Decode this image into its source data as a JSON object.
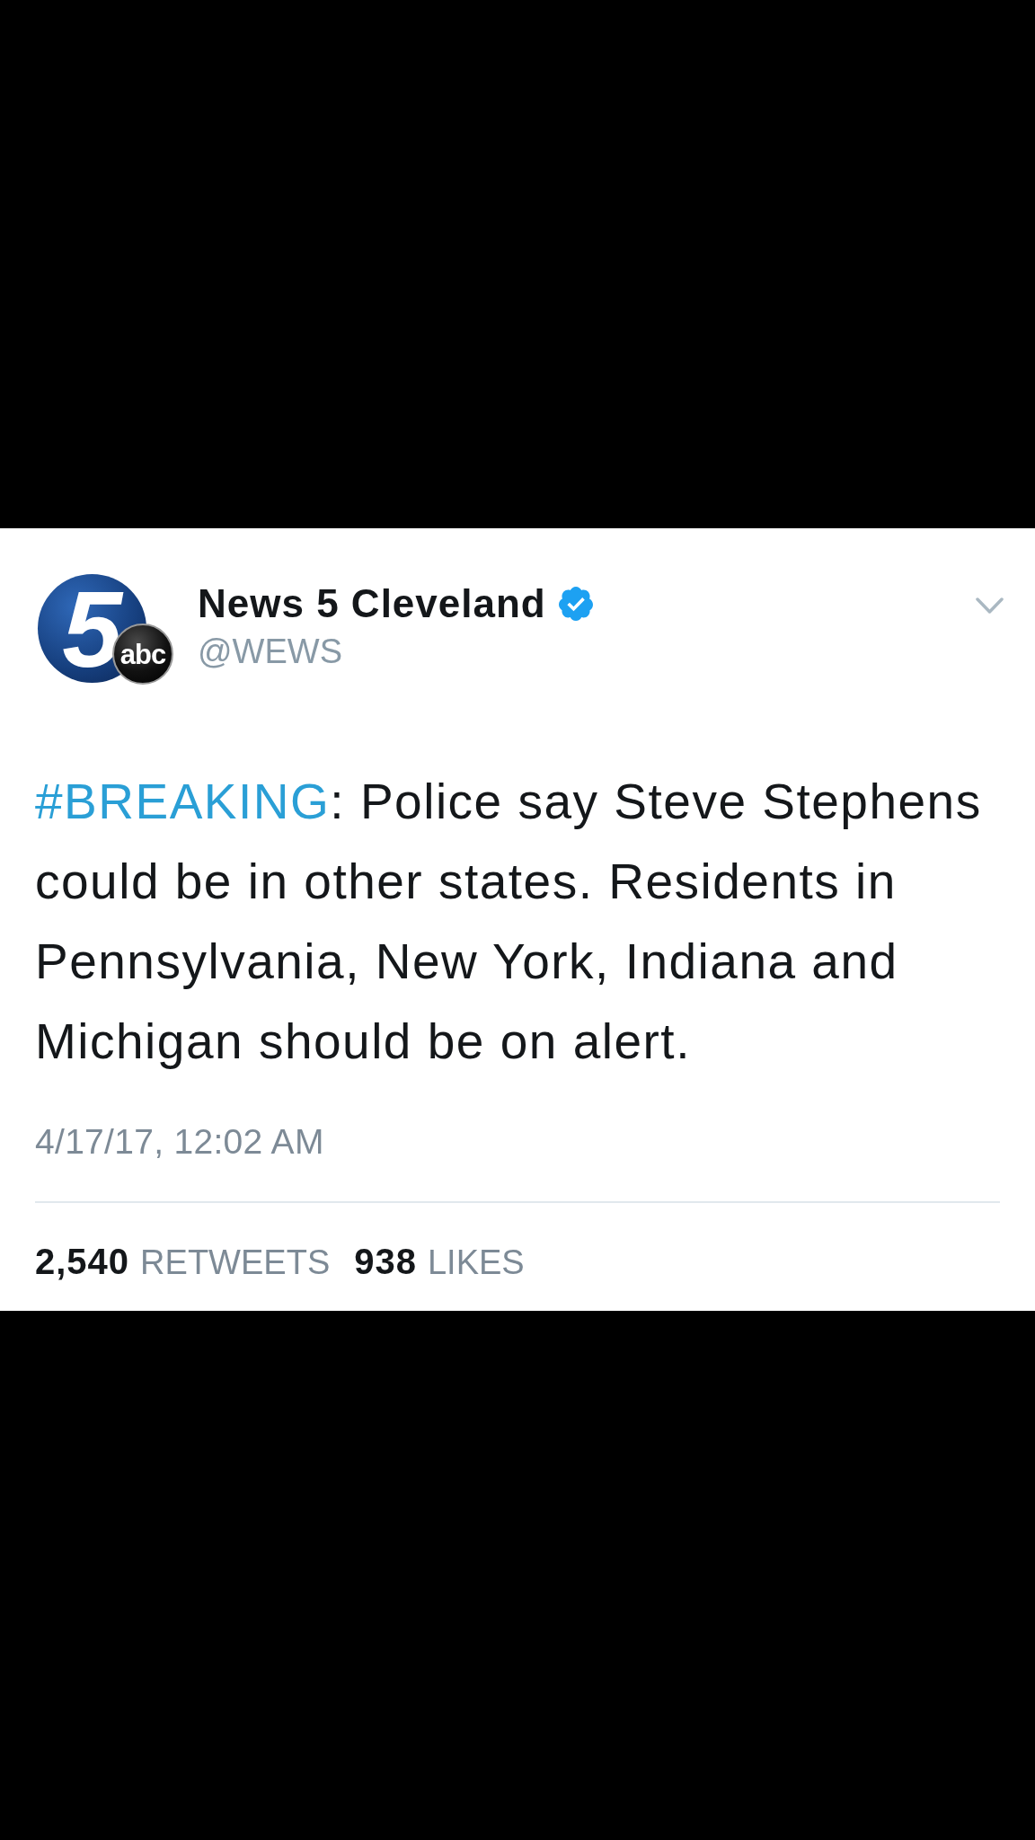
{
  "author": {
    "logo": {
      "numeral": "5",
      "network": "abc"
    },
    "name": "News 5 Cleveland",
    "verified": true,
    "handle": "@WEWS"
  },
  "tweet": {
    "hashtag": "#BREAKING",
    "text": ": Police say Steve Stephens could be in other states. Residents in Pennsylvania, New York, Indiana and Michigan should be on alert."
  },
  "timestamp": "4/17/17, 12:02 AM",
  "stats": [
    {
      "count": "2,540",
      "label": "RETWEETS"
    },
    {
      "count": "938",
      "label": "LIKES"
    }
  ]
}
